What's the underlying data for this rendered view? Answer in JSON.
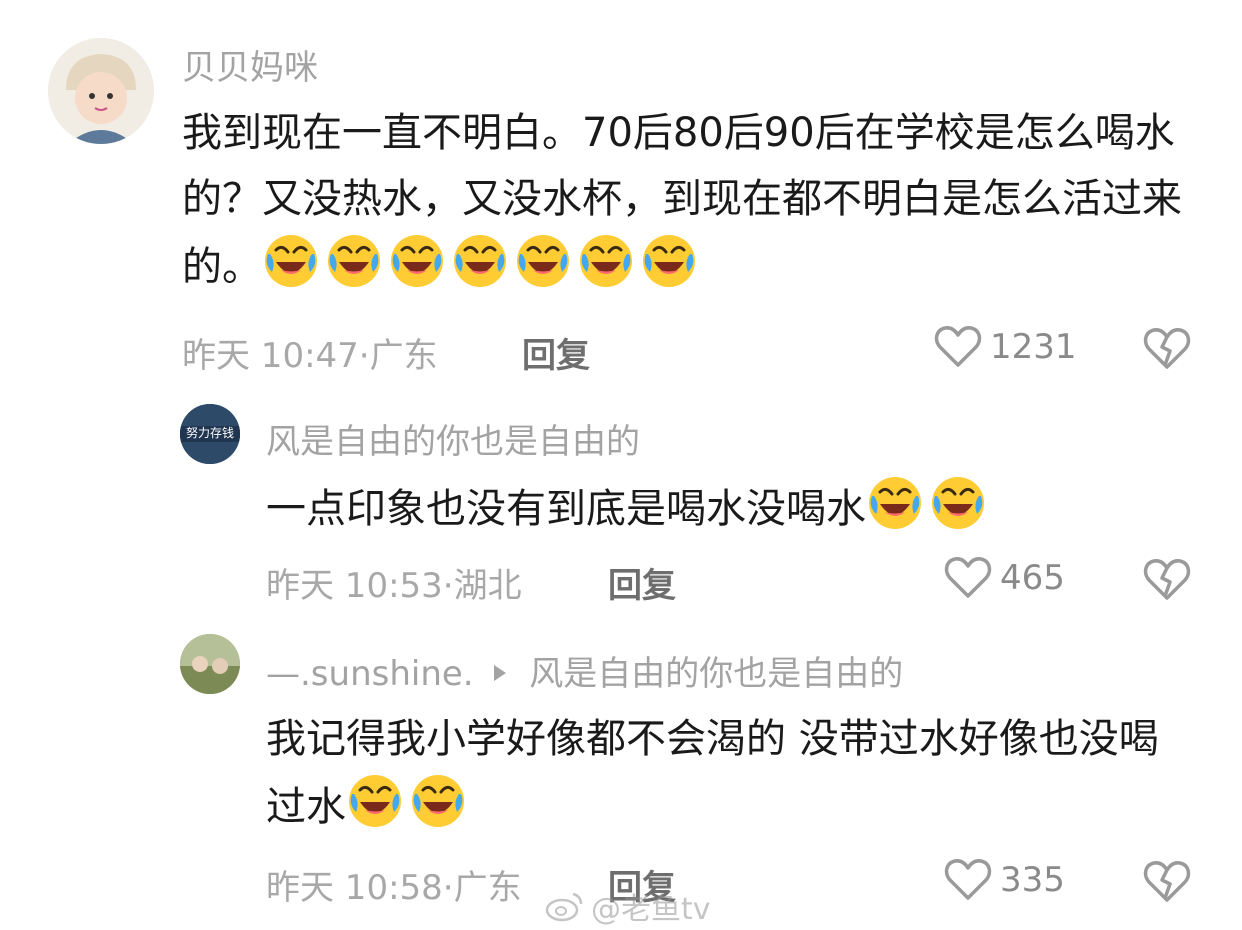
{
  "comments": [
    {
      "username": "贝贝妈咪",
      "text": "我到现在一直不明白。70后80后90后在学校是怎么喝水的？又没热水，又没水杯，到现在都不明白是怎么活过来的。",
      "emoji_icon": "laughing-crying-emoji",
      "emoji_count": 7,
      "time": "昨天 10:47",
      "location": "广东",
      "reply_label": "回复",
      "likes": "1231"
    },
    {
      "username": "风是自由的你也是自由的",
      "avatar_text": "努力存钱",
      "text": "一点印象也没有到底是喝水没喝水",
      "emoji_icon": "laughing-crying-emoji",
      "emoji_count": 2,
      "time": "昨天 10:53",
      "location": "湖北",
      "reply_label": "回复",
      "likes": "465"
    },
    {
      "username": "—.sunshine.",
      "reply_to": "风是自由的你也是自由的",
      "text": "我记得我小学好像都不会渴的 没带过水好像也没喝过水",
      "emoji_icon": "laughing-crying-emoji",
      "emoji_count": 2,
      "time": "昨天 10:58",
      "location": "广东",
      "reply_label": "回复",
      "likes": "335"
    }
  ],
  "watermark": "@老鱼tv"
}
